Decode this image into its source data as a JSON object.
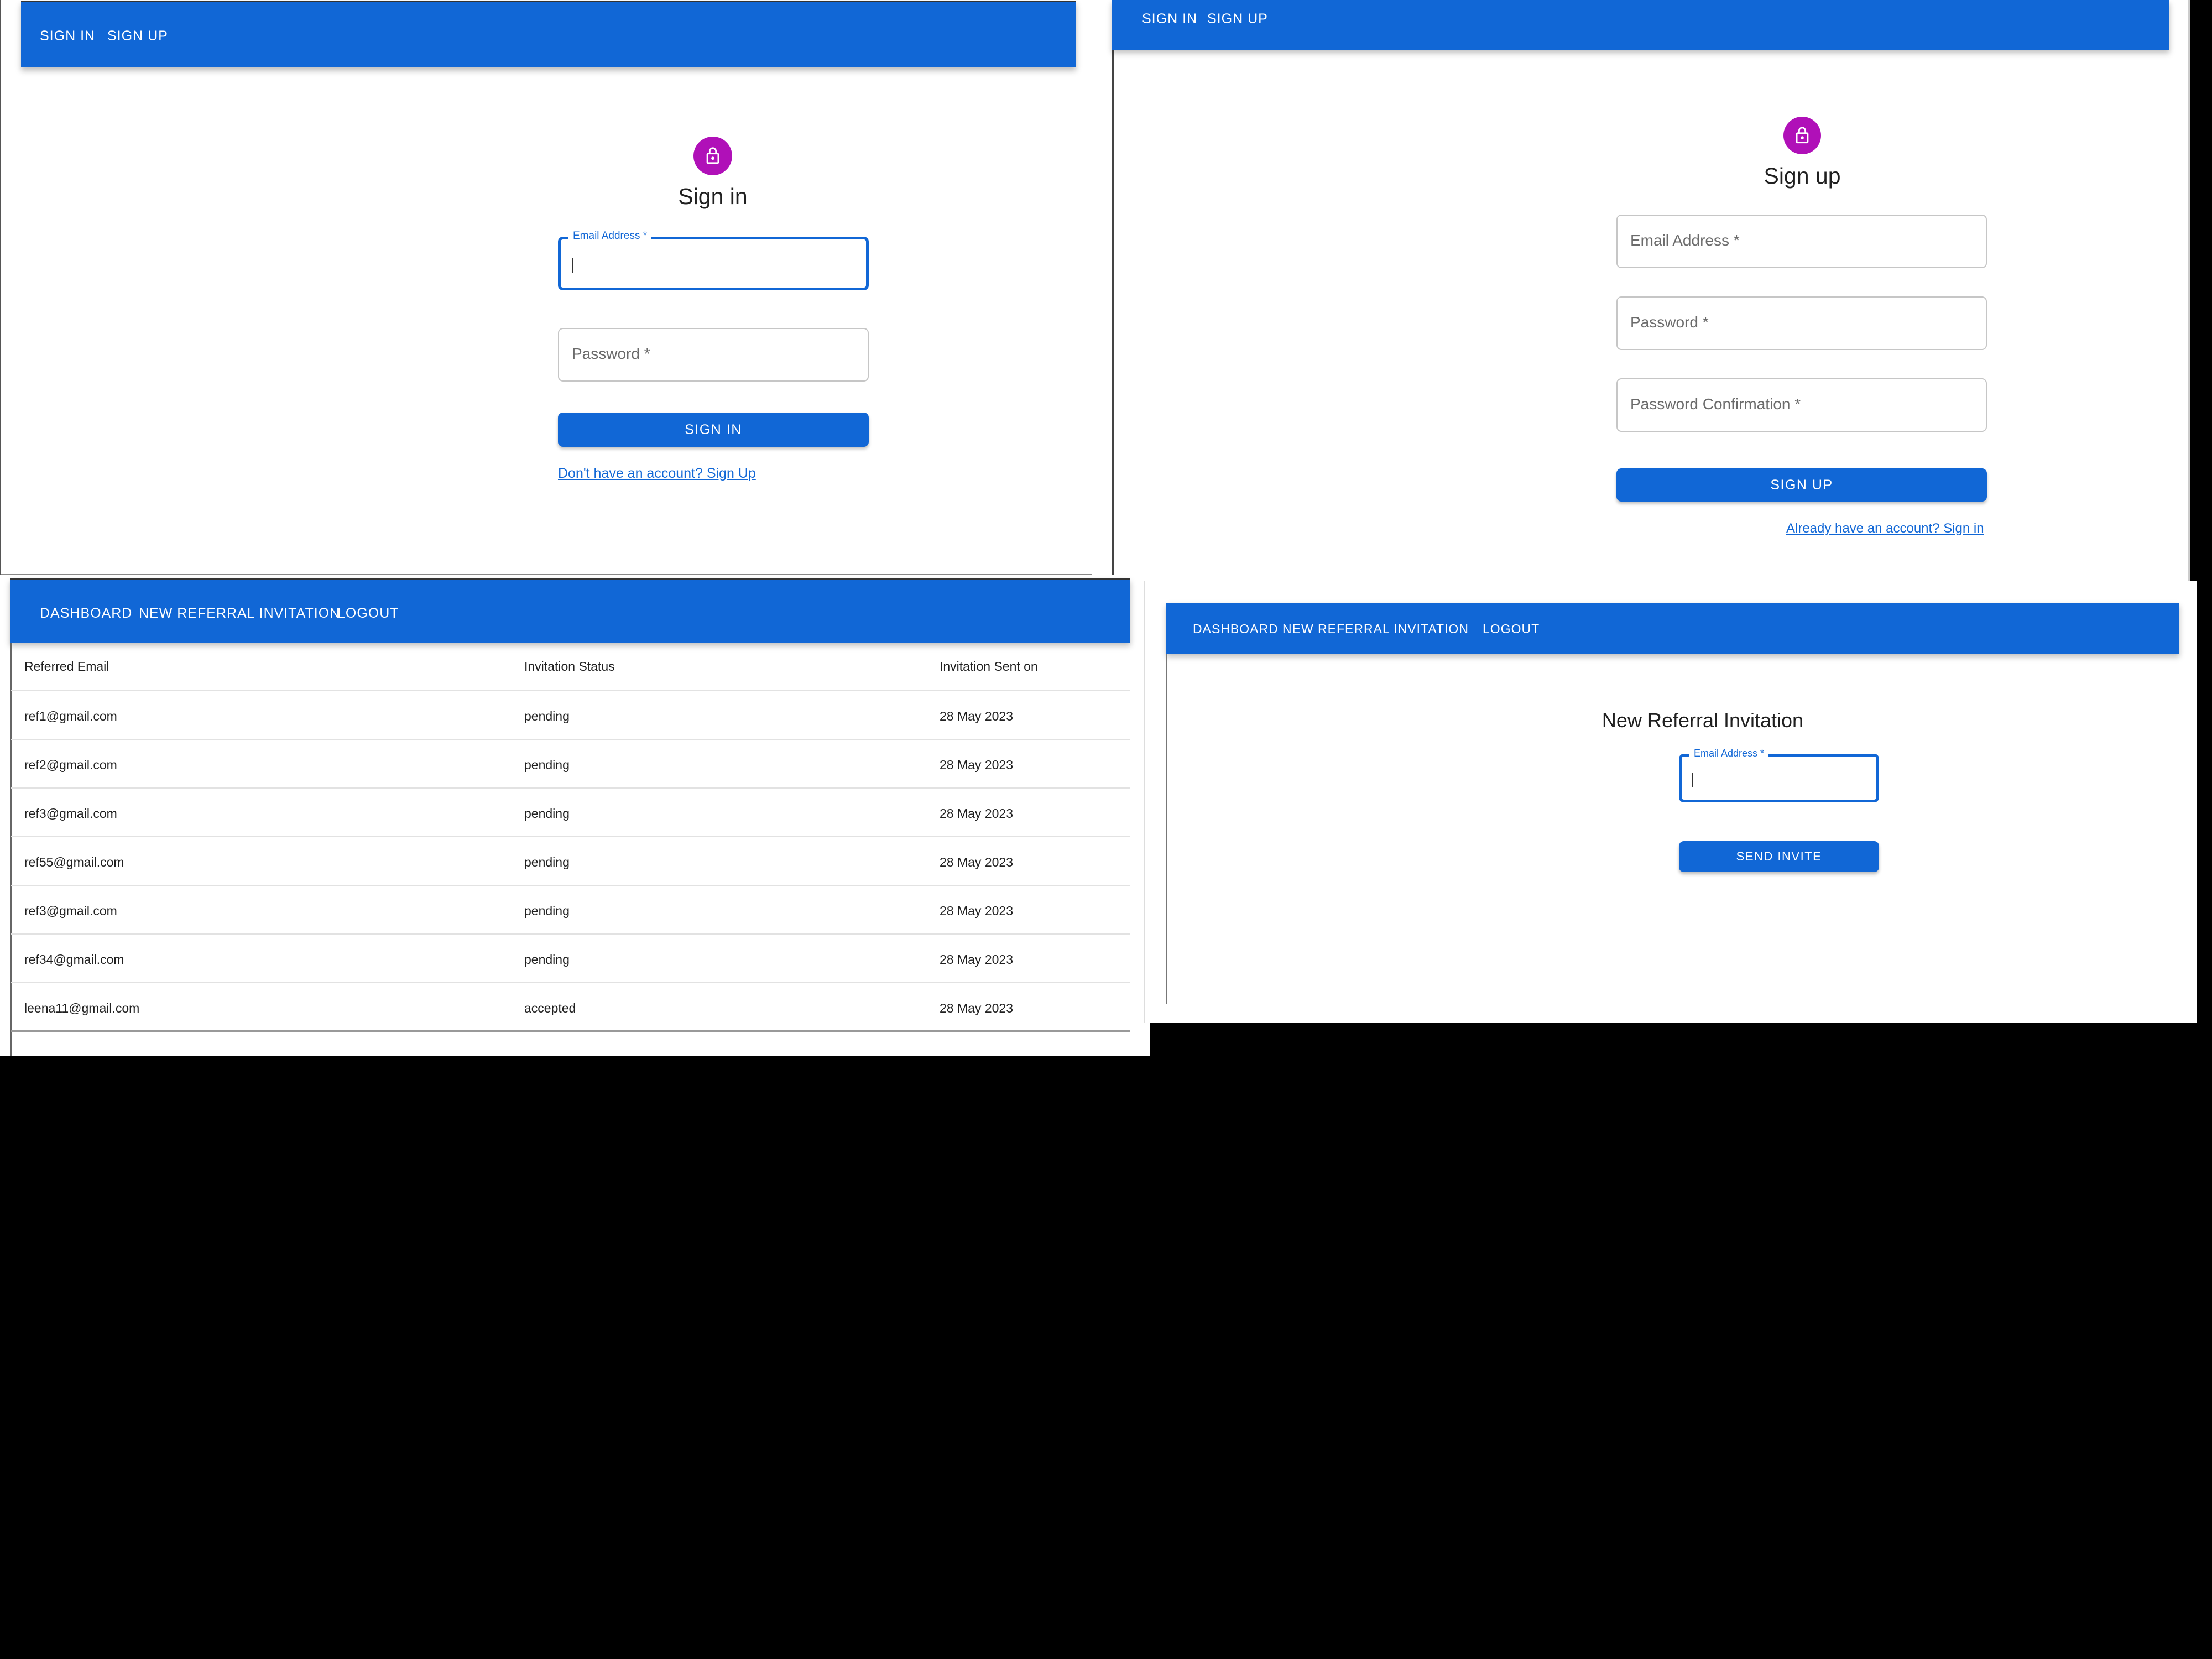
{
  "signin": {
    "nav": [
      "SIGN IN",
      "SIGN UP"
    ],
    "title": "Sign in",
    "email_label": "Email Address *",
    "password_placeholder": "Password *",
    "button": "SIGN IN",
    "link": "Don't have an account? Sign Up"
  },
  "signup": {
    "nav": [
      "SIGN IN",
      "SIGN UP"
    ],
    "title": "Sign up",
    "email_placeholder": "Email Address *",
    "password_placeholder": "Password *",
    "password_confirm_placeholder": "Password Confirmation *",
    "button": "SIGN UP",
    "link": "Already have an account? Sign in"
  },
  "dashboard": {
    "nav": [
      "DASHBOARD",
      "NEW REFERRAL INVITATION",
      "LOGOUT"
    ],
    "columns": [
      "Referred Email",
      "Invitation Status",
      "Invitation Sent on"
    ],
    "rows": [
      [
        "ref1@gmail.com",
        "pending",
        "28 May 2023"
      ],
      [
        "ref2@gmail.com",
        "pending",
        "28 May 2023"
      ],
      [
        "ref3@gmail.com",
        "pending",
        "28 May 2023"
      ],
      [
        "ref55@gmail.com",
        "pending",
        "28 May 2023"
      ],
      [
        "ref3@gmail.com",
        "pending",
        "28 May 2023"
      ],
      [
        "ref34@gmail.com",
        "pending",
        "28 May 2023"
      ],
      [
        "leena11@gmail.com",
        "accepted",
        "28 May 2023"
      ]
    ]
  },
  "invite": {
    "nav": [
      "DASHBOARD",
      "NEW REFERRAL INVITATION",
      "LOGOUT"
    ],
    "title": "New Referral Invitation",
    "email_label": "Email Address *",
    "button": "SEND INVITE"
  },
  "colors": {
    "primary": "#1167d6",
    "avatar": "#b010b8",
    "background": "#000000"
  }
}
